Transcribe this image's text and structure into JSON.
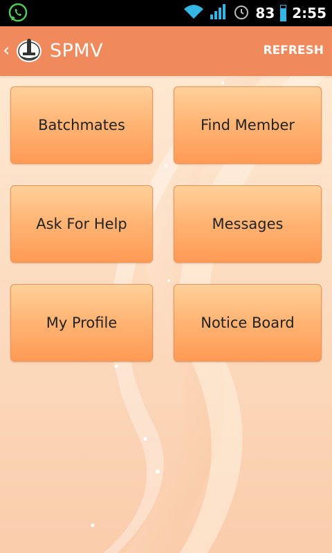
{
  "status_bar": {
    "battery_percent": "83",
    "time": "2:55",
    "battery_level": 0.83,
    "icons": [
      "whatsapp-icon",
      "wifi-icon",
      "signal-icon",
      "alarm-icon",
      "battery-icon"
    ]
  },
  "action_bar": {
    "title": "SPMV",
    "refresh_label": "REFRESH",
    "back_icon": "chevron-left-icon",
    "logo_icon": "spmv-logo-icon"
  },
  "menu": {
    "items": [
      {
        "label": "Batchmates"
      },
      {
        "label": "Find Member"
      },
      {
        "label": "Ask For Help"
      },
      {
        "label": "Messages"
      },
      {
        "label": "My Profile"
      },
      {
        "label": "Notice Board"
      }
    ]
  },
  "colors": {
    "action_bar": "#f08a5d",
    "tile_top": "#ffd09a",
    "tile_bottom": "#ff9a55",
    "background": "#fdebd8",
    "battery_accent": "#33b5e5"
  }
}
